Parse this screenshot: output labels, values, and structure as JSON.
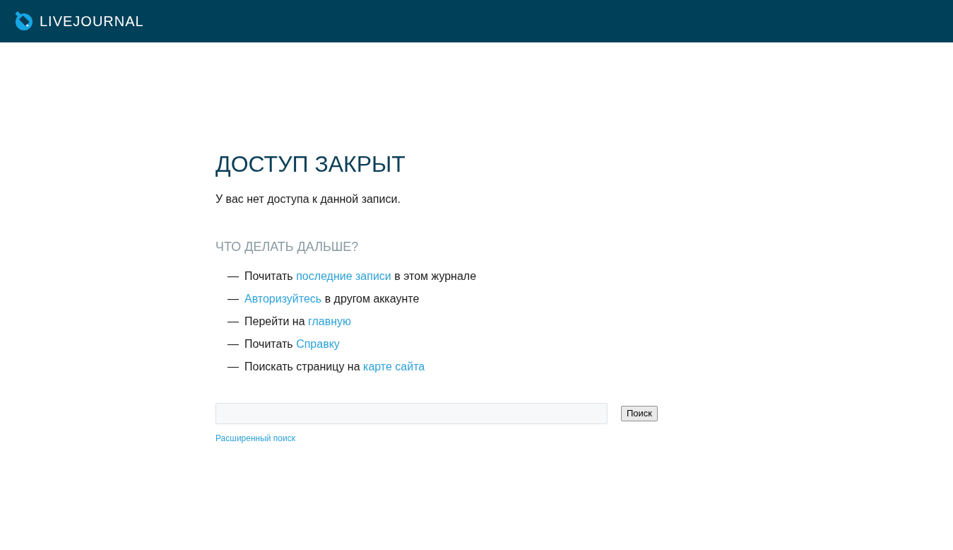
{
  "header": {
    "logo_text": "LIVEJOURNAL"
  },
  "title": "ДОСТУП ЗАКРЫТ",
  "message": "У вас нет доступа к данной записи.",
  "subtitle": "ЧТО ДЕЛАТЬ ДАЛЬШЕ?",
  "suggestions": [
    {
      "bullet": "—",
      "parts": [
        {
          "kind": "text",
          "text": "Почитать "
        },
        {
          "kind": "link",
          "text": "последние записи"
        },
        {
          "kind": "text",
          "text": " в этом журнале"
        }
      ]
    },
    {
      "bullet": "—",
      "parts": [
        {
          "kind": "link",
          "text": "Авторизуйтесь"
        },
        {
          "kind": "text",
          "text": " в другом аккаунте"
        }
      ]
    },
    {
      "bullet": "—",
      "parts": [
        {
          "kind": "text",
          "text": "Перейти на "
        },
        {
          "kind": "link",
          "text": "главную"
        }
      ]
    },
    {
      "bullet": "—",
      "parts": [
        {
          "kind": "text",
          "text": "Почитать "
        },
        {
          "kind": "link",
          "text": "Справку"
        }
      ]
    },
    {
      "bullet": "—",
      "parts": [
        {
          "kind": "text",
          "text": "Поискать страницу на "
        },
        {
          "kind": "link",
          "text": "карте сайта"
        }
      ]
    }
  ],
  "search": {
    "button": "Поиск",
    "advanced_link": "Расширенный поиск"
  }
}
